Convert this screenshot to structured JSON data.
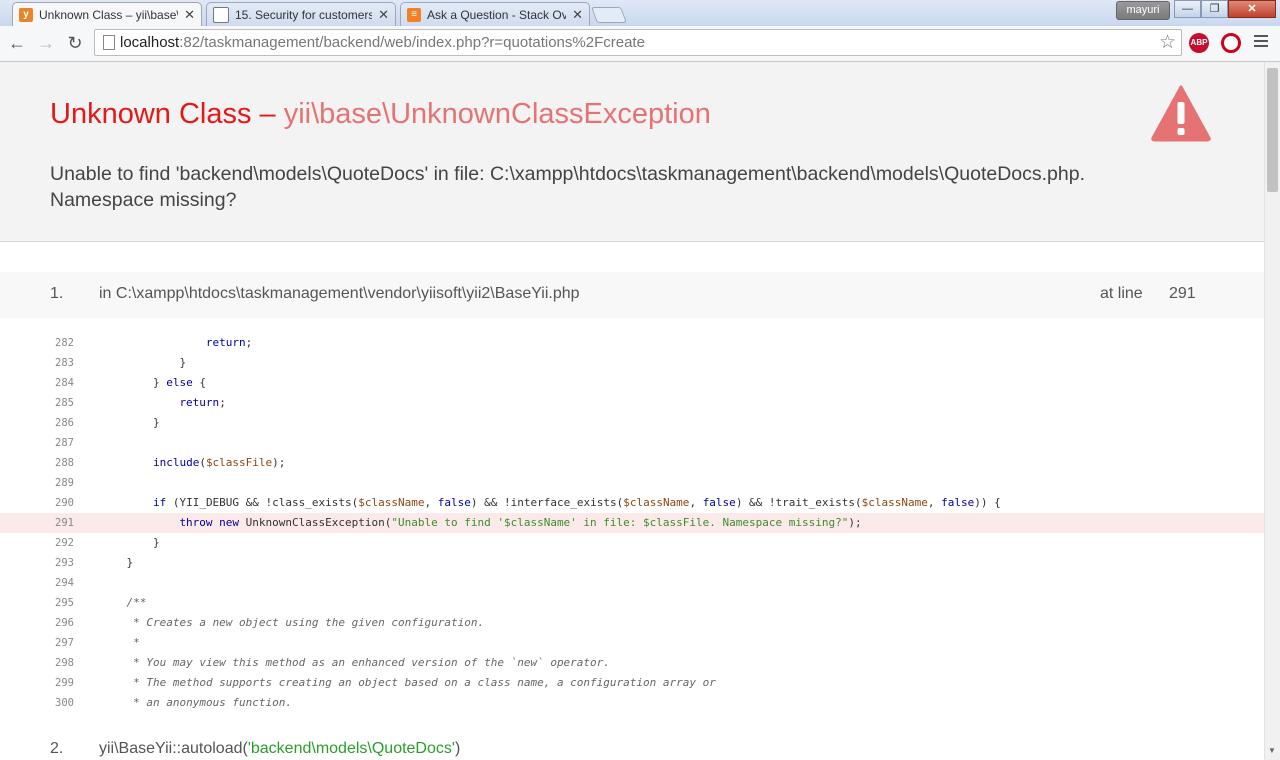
{
  "browser": {
    "tabs": [
      {
        "title": "Unknown Class – yii\\base\\UnknownClassException",
        "active": true,
        "favicon": "yii-icon"
      },
      {
        "title": "15. Security for customers",
        "active": false,
        "favicon": "doc-icon"
      },
      {
        "title": "Ask a Question - Stack Overflow",
        "active": false,
        "favicon": "stackoverflow-icon"
      }
    ],
    "user": "mayuri",
    "url_host": "localhost",
    "url_rest": ":82/taskmanagement/backend/web/index.php?r=quotations%2Fcreate",
    "extensions": [
      {
        "name": "adblock-plus-icon",
        "label": "ABP",
        "color": "#c70d2c"
      },
      {
        "name": "opera-icon",
        "label": "O",
        "color": "#d0021b"
      }
    ]
  },
  "error": {
    "title_prefix": "Unknown Class – ",
    "title_class": "yii\\base\\UnknownClassException",
    "message": "Unable to find 'backend\\models\\QuoteDocs' in file: C:\\xampp\\htdocs\\taskmanagement\\backend\\models\\QuoteDocs.php. Namespace missing?"
  },
  "frames": [
    {
      "num": "1.",
      "file": "in C:\\xampp\\htdocs\\taskmanagement\\vendor\\yiisoft\\yii2\\BaseYii.php",
      "at_line_label": "at line",
      "line": "291"
    },
    {
      "num": "2.",
      "call_prefix": "yii\\BaseYii::autoload(",
      "call_arg": "'backend\\models\\QuoteDocs'",
      "call_suffix": ")"
    }
  ],
  "code": {
    "highlight_line": "291",
    "lines": [
      {
        "n": "282",
        "indent": 16,
        "parts": [
          {
            "c": "kw",
            "t": "return"
          },
          {
            "c": "",
            "t": ";"
          }
        ]
      },
      {
        "n": "283",
        "indent": 12,
        "parts": [
          {
            "c": "",
            "t": "}"
          }
        ]
      },
      {
        "n": "284",
        "indent": 8,
        "parts": [
          {
            "c": "",
            "t": "} "
          },
          {
            "c": "kw",
            "t": "else"
          },
          {
            "c": "",
            "t": " {"
          }
        ]
      },
      {
        "n": "285",
        "indent": 12,
        "parts": [
          {
            "c": "kw",
            "t": "return"
          },
          {
            "c": "",
            "t": ";"
          }
        ]
      },
      {
        "n": "286",
        "indent": 8,
        "parts": [
          {
            "c": "",
            "t": "}"
          }
        ]
      },
      {
        "n": "287",
        "indent": 0,
        "parts": []
      },
      {
        "n": "288",
        "indent": 8,
        "parts": [
          {
            "c": "kw",
            "t": "include"
          },
          {
            "c": "",
            "t": "("
          },
          {
            "c": "var",
            "t": "$classFile"
          },
          {
            "c": "",
            "t": ");"
          }
        ]
      },
      {
        "n": "289",
        "indent": 0,
        "parts": []
      },
      {
        "n": "290",
        "indent": 8,
        "parts": [
          {
            "c": "kw",
            "t": "if"
          },
          {
            "c": "",
            "t": " (YII_DEBUG && !class_exists("
          },
          {
            "c": "var",
            "t": "$className"
          },
          {
            "c": "",
            "t": ", "
          },
          {
            "c": "kw",
            "t": "false"
          },
          {
            "c": "",
            "t": ") && !interface_exists("
          },
          {
            "c": "var",
            "t": "$className"
          },
          {
            "c": "",
            "t": ", "
          },
          {
            "c": "kw",
            "t": "false"
          },
          {
            "c": "",
            "t": ") && !trait_exists("
          },
          {
            "c": "var",
            "t": "$className"
          },
          {
            "c": "",
            "t": ", "
          },
          {
            "c": "kw",
            "t": "false"
          },
          {
            "c": "",
            "t": ")) {"
          }
        ]
      },
      {
        "n": "291",
        "indent": 12,
        "parts": [
          {
            "c": "kw",
            "t": "throw new"
          },
          {
            "c": "",
            "t": " UnknownClassException("
          },
          {
            "c": "str",
            "t": "\"Unable to find '$className' in file: $classFile. Namespace missing?\""
          },
          {
            "c": "",
            "t": ");"
          }
        ]
      },
      {
        "n": "292",
        "indent": 8,
        "parts": [
          {
            "c": "",
            "t": "}"
          }
        ]
      },
      {
        "n": "293",
        "indent": 4,
        "parts": [
          {
            "c": "",
            "t": "}"
          }
        ]
      },
      {
        "n": "294",
        "indent": 0,
        "parts": []
      },
      {
        "n": "295",
        "indent": 4,
        "parts": [
          {
            "c": "cm",
            "t": "/**"
          }
        ]
      },
      {
        "n": "296",
        "indent": 5,
        "parts": [
          {
            "c": "cm",
            "t": "* Creates a new object using the given configuration."
          }
        ]
      },
      {
        "n": "297",
        "indent": 5,
        "parts": [
          {
            "c": "cm",
            "t": "*"
          }
        ]
      },
      {
        "n": "298",
        "indent": 5,
        "parts": [
          {
            "c": "cm",
            "t": "* You may view this method as an enhanced version of the `new` operator."
          }
        ]
      },
      {
        "n": "299",
        "indent": 5,
        "parts": [
          {
            "c": "cm",
            "t": "* The method supports creating an object based on a class name, a configuration array or"
          }
        ]
      },
      {
        "n": "300",
        "indent": 5,
        "parts": [
          {
            "c": "cm",
            "t": "* an anonymous function."
          }
        ]
      }
    ]
  }
}
